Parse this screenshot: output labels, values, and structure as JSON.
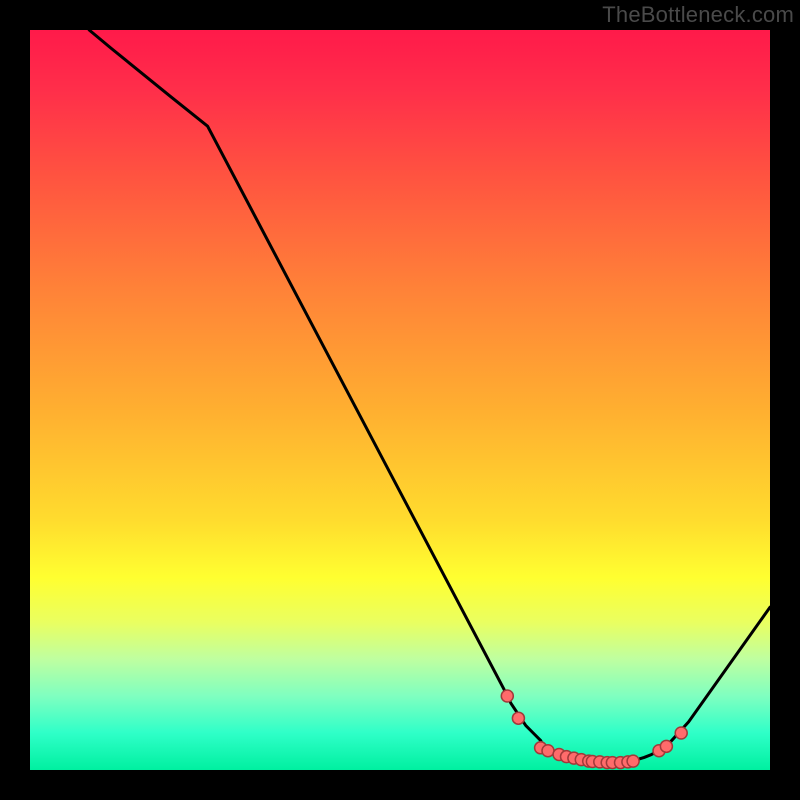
{
  "watermark": "TheBottleneck.com",
  "colors": {
    "dot_fill": "#ff6b6b",
    "dot_stroke": "#a13a3a",
    "curve": "#000000"
  },
  "chart_data": {
    "type": "line",
    "title": "",
    "xlabel": "",
    "ylabel": "",
    "xlim": [
      0,
      100
    ],
    "ylim": [
      0,
      100
    ],
    "grid": false,
    "legend": false,
    "series": [
      {
        "name": "curve",
        "x": [
          8,
          11,
          19,
          24,
          64,
          65,
          67,
          68,
          69,
          69.5,
          70,
          71,
          72,
          73,
          74,
          75,
          76,
          77,
          78,
          79,
          80,
          81,
          82,
          83,
          84,
          85,
          86,
          89,
          100
        ],
        "y": [
          100,
          97.5,
          91,
          87,
          11,
          9,
          6,
          5,
          4,
          3,
          2.6,
          2.2,
          1.9,
          1.6,
          1.4,
          1.2,
          1.1,
          1.0,
          1.0,
          1.0,
          1.1,
          1.2,
          1.4,
          1.7,
          2.1,
          2.6,
          3.2,
          6.5,
          22
        ]
      }
    ],
    "dots": {
      "x": [
        64.5,
        66.0,
        69.0,
        70.0,
        71.5,
        72.5,
        73.5,
        74.5,
        75.5,
        76.0,
        77.0,
        78.0,
        78.7,
        79.8,
        80.8,
        81.5,
        85.0,
        86.0,
        88.0
      ],
      "y": [
        10.0,
        7.0,
        3.0,
        2.6,
        2.1,
        1.8,
        1.6,
        1.4,
        1.2,
        1.15,
        1.1,
        1.0,
        1.0,
        1.0,
        1.1,
        1.2,
        2.6,
        3.2,
        5.0
      ]
    }
  }
}
